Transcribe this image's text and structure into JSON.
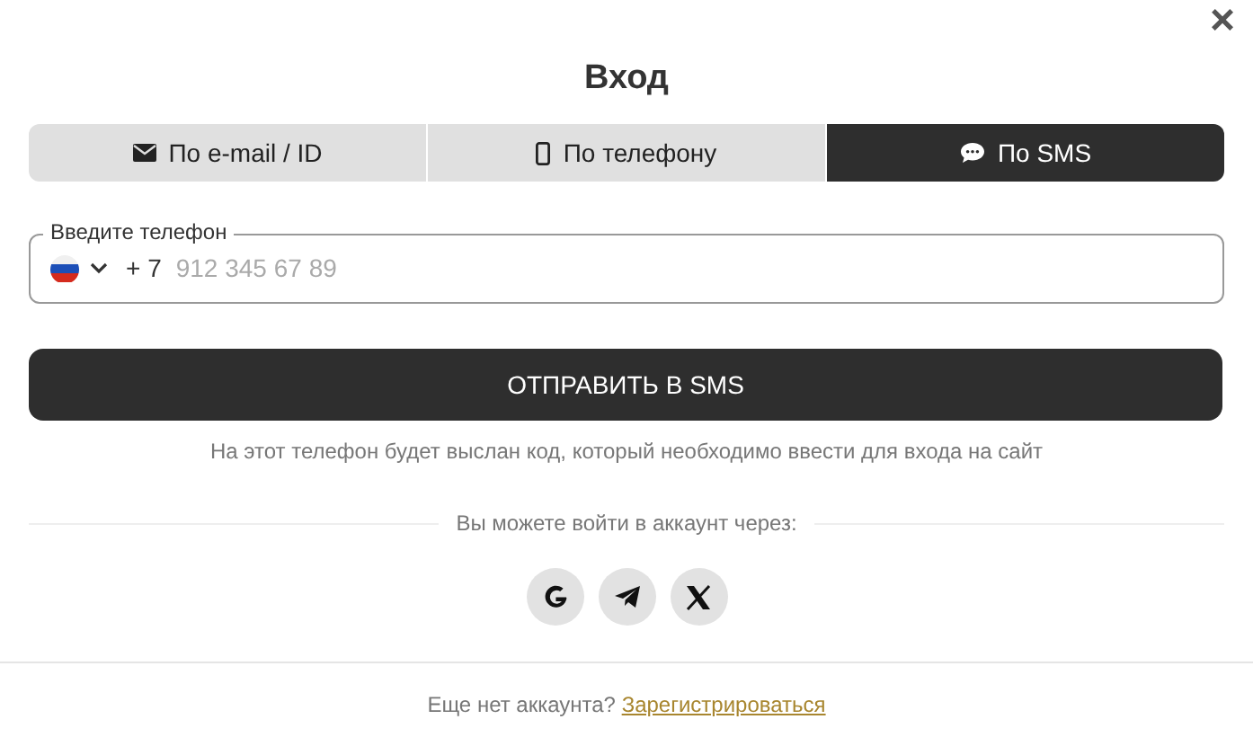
{
  "dialog": {
    "title": "Вход",
    "close": "×"
  },
  "tabs": [
    {
      "label": "По e-mail / ID",
      "selected": false
    },
    {
      "label": "По телефону",
      "selected": false
    },
    {
      "label": "По SMS",
      "selected": true
    }
  ],
  "phone_field": {
    "label": "Введите телефон",
    "prefix": "+ 7",
    "placeholder": "912 345 67 89"
  },
  "submit_button": "ОТПРАВИТЬ В SMS",
  "hint": "На этот телефон будет выслан код, который необходимо ввести для входа на сайт",
  "social_caption": "Вы можете войти в аккаунт через:",
  "footer": {
    "text": "Еще нет аккаунта?",
    "link": "Зарегистрироваться"
  }
}
